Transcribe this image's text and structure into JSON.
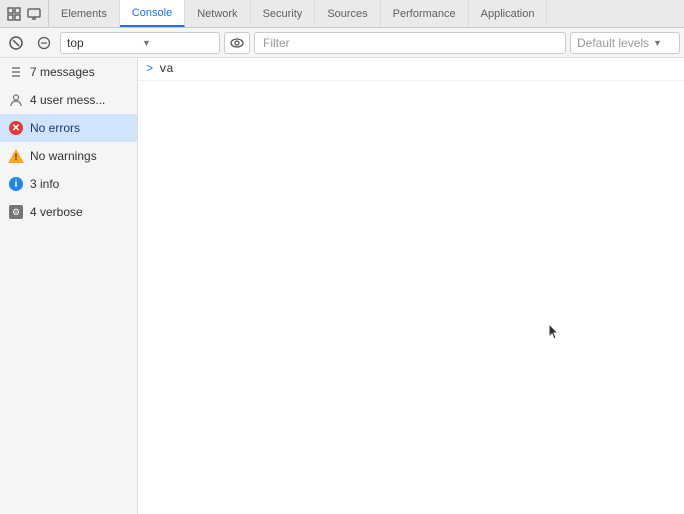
{
  "tabs": [
    {
      "id": "elements",
      "label": "Elements",
      "active": false
    },
    {
      "id": "console",
      "label": "Console",
      "active": true
    },
    {
      "id": "network",
      "label": "Network",
      "active": false
    },
    {
      "id": "security",
      "label": "Security",
      "active": false
    },
    {
      "id": "sources",
      "label": "Sources",
      "active": false
    },
    {
      "id": "performance",
      "label": "Performance",
      "active": false
    },
    {
      "id": "application",
      "label": "Application",
      "active": false
    }
  ],
  "toolbar": {
    "context": "top",
    "filter_placeholder": "Filter",
    "levels_placeholder": "Default levels"
  },
  "sidebar": {
    "items": [
      {
        "id": "messages",
        "icon": "list",
        "label": "7 messages"
      },
      {
        "id": "user-messages",
        "icon": "user",
        "label": "4 user mess..."
      },
      {
        "id": "errors",
        "icon": "error",
        "label": "No errors",
        "active": true
      },
      {
        "id": "warnings",
        "icon": "warning",
        "label": "No warnings"
      },
      {
        "id": "info",
        "icon": "info",
        "label": "3 info"
      },
      {
        "id": "verbose",
        "icon": "verbose",
        "label": "4 verbose"
      }
    ]
  },
  "console": {
    "lines": [
      {
        "arrow": ">",
        "text": "va"
      }
    ]
  }
}
